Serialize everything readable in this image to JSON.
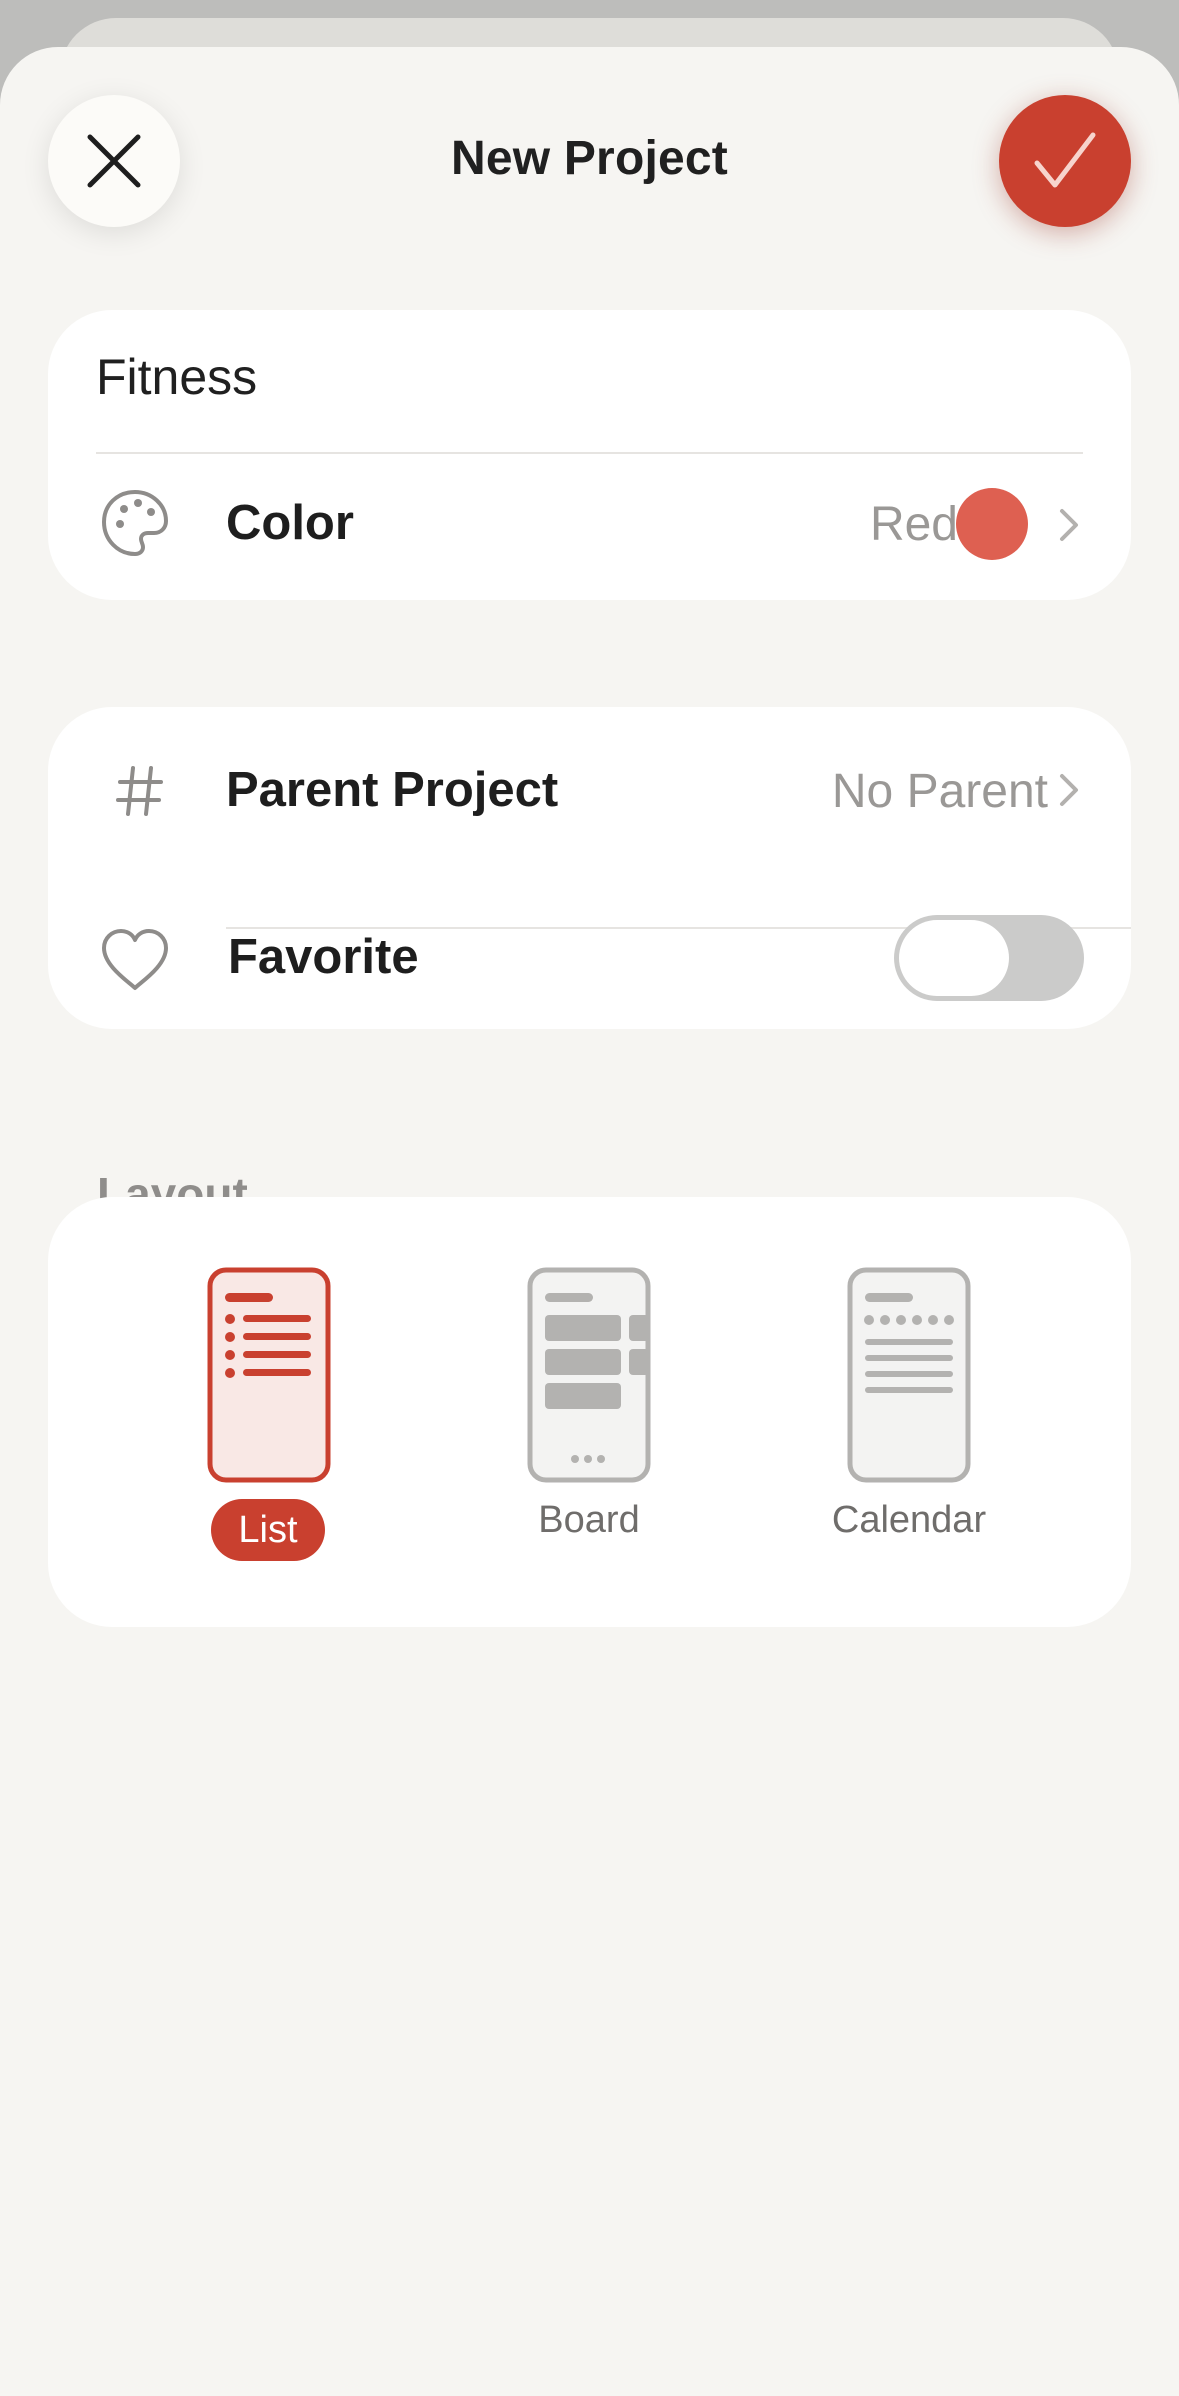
{
  "header": {
    "title": "New Project",
    "close_icon": "close-icon",
    "confirm_icon": "check-icon"
  },
  "project": {
    "name": "Fitness",
    "color": {
      "label": "Color",
      "value": "Red",
      "swatch": "#de6051",
      "icon": "palette-icon"
    },
    "parent": {
      "label": "Parent Project",
      "value": "No Parent",
      "icon": "hash-icon"
    },
    "favorite": {
      "label": "Favorite",
      "enabled": false,
      "icon": "heart-icon"
    }
  },
  "layout": {
    "section_label": "Layout",
    "selected": "List",
    "options": [
      {
        "label": "List",
        "icon": "list-layout-icon",
        "selected": true
      },
      {
        "label": "Board",
        "icon": "board-layout-icon",
        "selected": false
      },
      {
        "label": "Calendar",
        "icon": "calendar-layout-icon",
        "selected": false
      }
    ]
  },
  "colors": {
    "accent": "#c9402f",
    "background": "#f6f5f2",
    "card": "#ffffff",
    "muted_text": "#9a9896"
  }
}
